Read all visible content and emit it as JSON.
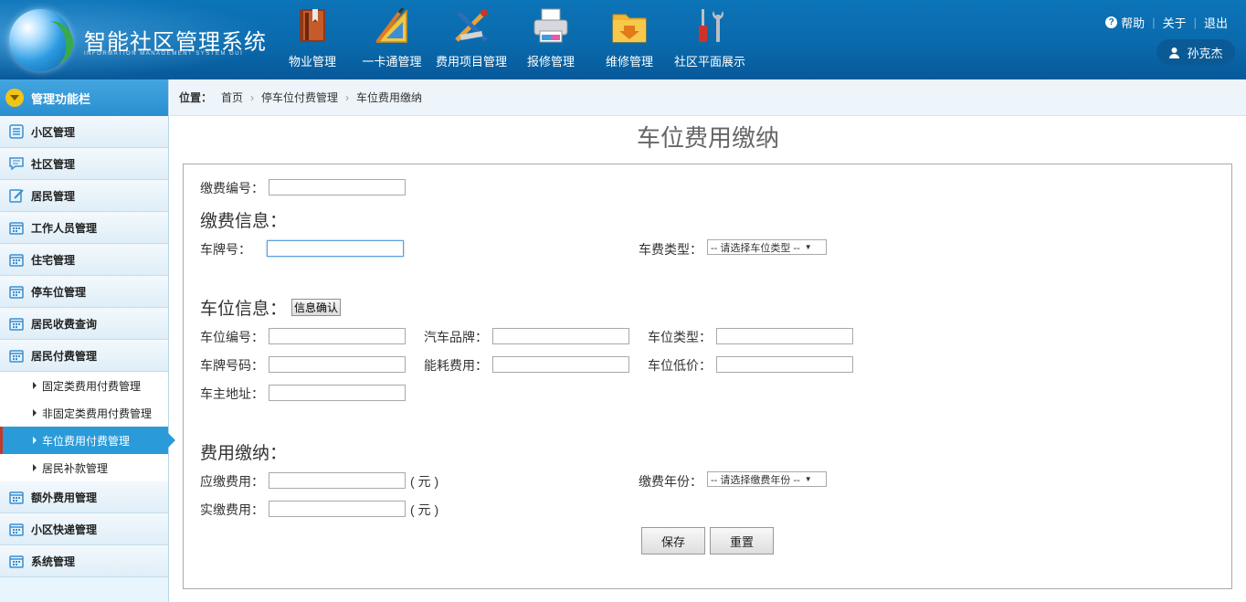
{
  "header": {
    "app_title": "智能社区管理系统",
    "app_subtitle": "INFORMATION MANAGEMENT SYSTEM GUI",
    "nav": [
      {
        "label": "物业管理",
        "icon": "book-icon"
      },
      {
        "label": "一卡通管理",
        "icon": "ruler-triangle-icon"
      },
      {
        "label": "费用项目管理",
        "icon": "tools-pencil-icon"
      },
      {
        "label": "报修管理",
        "icon": "printer-icon"
      },
      {
        "label": "维修管理",
        "icon": "folder-download-icon"
      },
      {
        "label": "社区平面展示",
        "icon": "screwdriver-wrench-icon"
      }
    ],
    "links": {
      "help": "帮助",
      "about": "关于",
      "logout": "退出"
    },
    "user_name": "孙克杰"
  },
  "sidebar": {
    "title": "管理功能栏",
    "items": [
      {
        "label": "小区管理",
        "icon": "list-icon"
      },
      {
        "label": "社区管理",
        "icon": "chat-icon"
      },
      {
        "label": "居民管理",
        "icon": "edit-icon"
      },
      {
        "label": "工作人员管理",
        "icon": "calendar-icon"
      },
      {
        "label": "住宅管理",
        "icon": "calendar-icon"
      },
      {
        "label": "停车位管理",
        "icon": "calendar-icon"
      },
      {
        "label": "居民收费查询",
        "icon": "calendar-icon"
      },
      {
        "label": "居民付费管理",
        "icon": "calendar-icon"
      }
    ],
    "subitems": [
      {
        "label": "固定类费用付费管理"
      },
      {
        "label": "非固定类费用付费管理"
      },
      {
        "label": "车位费用付费管理",
        "active": true
      },
      {
        "label": "居民补款管理"
      }
    ],
    "items_after": [
      {
        "label": "额外费用管理",
        "icon": "calendar-icon"
      },
      {
        "label": "小区快递管理",
        "icon": "calendar-icon"
      },
      {
        "label": "系统管理",
        "icon": "calendar-icon"
      }
    ]
  },
  "breadcrumb": {
    "label": "位置：",
    "items": [
      "首页",
      "停车位付费管理",
      "车位费用缴纳"
    ]
  },
  "page_title": "车位费用缴纳",
  "form": {
    "payment_no_label": "缴费编号：",
    "payment_no_value": "",
    "section_payment": "缴费信息：",
    "plate_label": "车牌号：",
    "plate_value": "",
    "fee_type_label": "车费类型：",
    "fee_type_selected": "-- 请选择车位类型 --",
    "section_space": "车位信息：",
    "confirm_button": "信息确认",
    "space_no_label": "车位编号：",
    "car_brand_label": "汽车品牌：",
    "space_type_label": "车位类型：",
    "plate_no_label": "车牌号码：",
    "energy_fee_label": "能耗费用：",
    "space_price_label": "车位低价：",
    "owner_addr_label": "车主地址：",
    "section_fee": "费用缴纳：",
    "due_label": "应缴费用：",
    "paid_label": "实缴费用：",
    "unit": "( 元 )",
    "year_label": "缴费年份：",
    "year_selected": "-- 请选择缴费年份 --",
    "save_button": "保存",
    "reset_button": "重置"
  },
  "colors": {
    "header_blue": "#0a6aac",
    "sidebar_active": "#2a9bd8",
    "sidebar_toggle": "#f0c419"
  }
}
